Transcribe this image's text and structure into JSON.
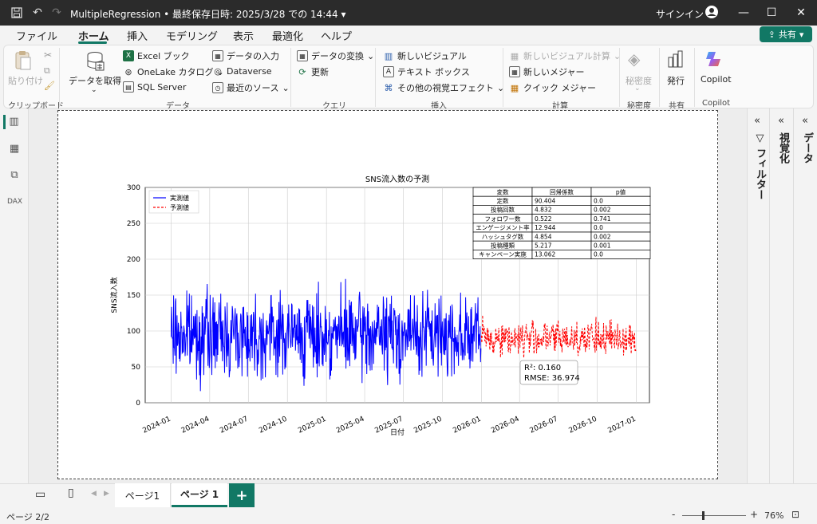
{
  "window": {
    "doc_title": "MultipleRegression • 最終保存日時: 2025/3/28 での 14:44",
    "signin": "サインイン",
    "min": "—",
    "max": "☐",
    "close": "✕"
  },
  "menu": {
    "tabs": [
      "ファイル",
      "ホーム",
      "挿入",
      "モデリング",
      "表示",
      "最適化",
      "ヘルプ"
    ],
    "share": "共有"
  },
  "ribbon": {
    "clipboard": {
      "paste": "貼り付け",
      "label": "クリップボード"
    },
    "data": {
      "get_data": "データを取得",
      "excel": "Excel ブック",
      "onelake": "OneLake カタログ",
      "sql": "SQL Server",
      "enter_data": "データの入力",
      "dataverse": "Dataverse",
      "recent": "最近のソース",
      "label": "データ"
    },
    "query": {
      "transform": "データの変換",
      "refresh": "更新",
      "label": "クエリ"
    },
    "insert": {
      "new_visual": "新しいビジュアル",
      "text_box": "テキスト ボックス",
      "more_visuals": "その他の視覚エフェクト",
      "label": "挿入"
    },
    "calc": {
      "new_visual_calc": "新しいビジュアル計算",
      "new_measure": "新しいメジャー",
      "quick_measure": "クイック メジャー",
      "label": "計算"
    },
    "sensitivity": {
      "btn": "秘密度",
      "label": "秘密度"
    },
    "share": {
      "publish": "発行",
      "label": "共有"
    },
    "copilot": {
      "btn": "Copilot",
      "label": "Copilot"
    }
  },
  "panes": {
    "filters": "フィルター",
    "visualize": "視覚化",
    "data": "データ"
  },
  "pages": {
    "tab1": "ページ1",
    "tab2": "ページ 1",
    "add": "+"
  },
  "status": {
    "page": "ページ 2/2",
    "zoom": "76%"
  },
  "chart_data": {
    "type": "line",
    "title": "SNS流入数の予測",
    "xlabel": "日付",
    "ylabel": "SNS流入数",
    "ylim": [
      0,
      300
    ],
    "yticks": [
      0,
      50,
      100,
      150,
      200,
      250,
      300
    ],
    "xticks": [
      "2024-01",
      "2024-04",
      "2024-07",
      "2024-10",
      "2025-01",
      "2025-04",
      "2025-07",
      "2025-10",
      "2026-01",
      "2026-04",
      "2026-07",
      "2026-10",
      "2027-01"
    ],
    "xrange": [
      "2023-11",
      "2027-02"
    ],
    "series": [
      {
        "name": "実測値",
        "color": "#0000ff",
        "style": "solid",
        "x_start": "2024-01-01",
        "x_end": "2025-12-31",
        "mean": 95,
        "spread": 40
      },
      {
        "name": "予測値",
        "color": "#ff0000",
        "style": "dashed",
        "x_start": "2026-01-01",
        "x_end": "2026-12-31",
        "mean": 90,
        "spread": 17
      }
    ],
    "table": {
      "headers": [
        "変数",
        "回帰係数",
        "p値"
      ],
      "rows": [
        [
          "定数",
          "90.404",
          "0.0"
        ],
        [
          "投稿回数",
          "4.832",
          "0.002"
        ],
        [
          "フォロワー数",
          "0.522",
          "0.741"
        ],
        [
          "エンゲージメント率",
          "12.944",
          "0.0"
        ],
        [
          "ハッシュタグ数",
          "4.854",
          "0.002"
        ],
        [
          "投稿種類",
          "5.217",
          "0.001"
        ],
        [
          "キャンペーン実施",
          "13.062",
          "0.0"
        ]
      ]
    },
    "stats": {
      "r2": "R²: 0.160",
      "rmse": "RMSE: 36.974"
    },
    "grid": true,
    "legend_position": "top-left"
  }
}
